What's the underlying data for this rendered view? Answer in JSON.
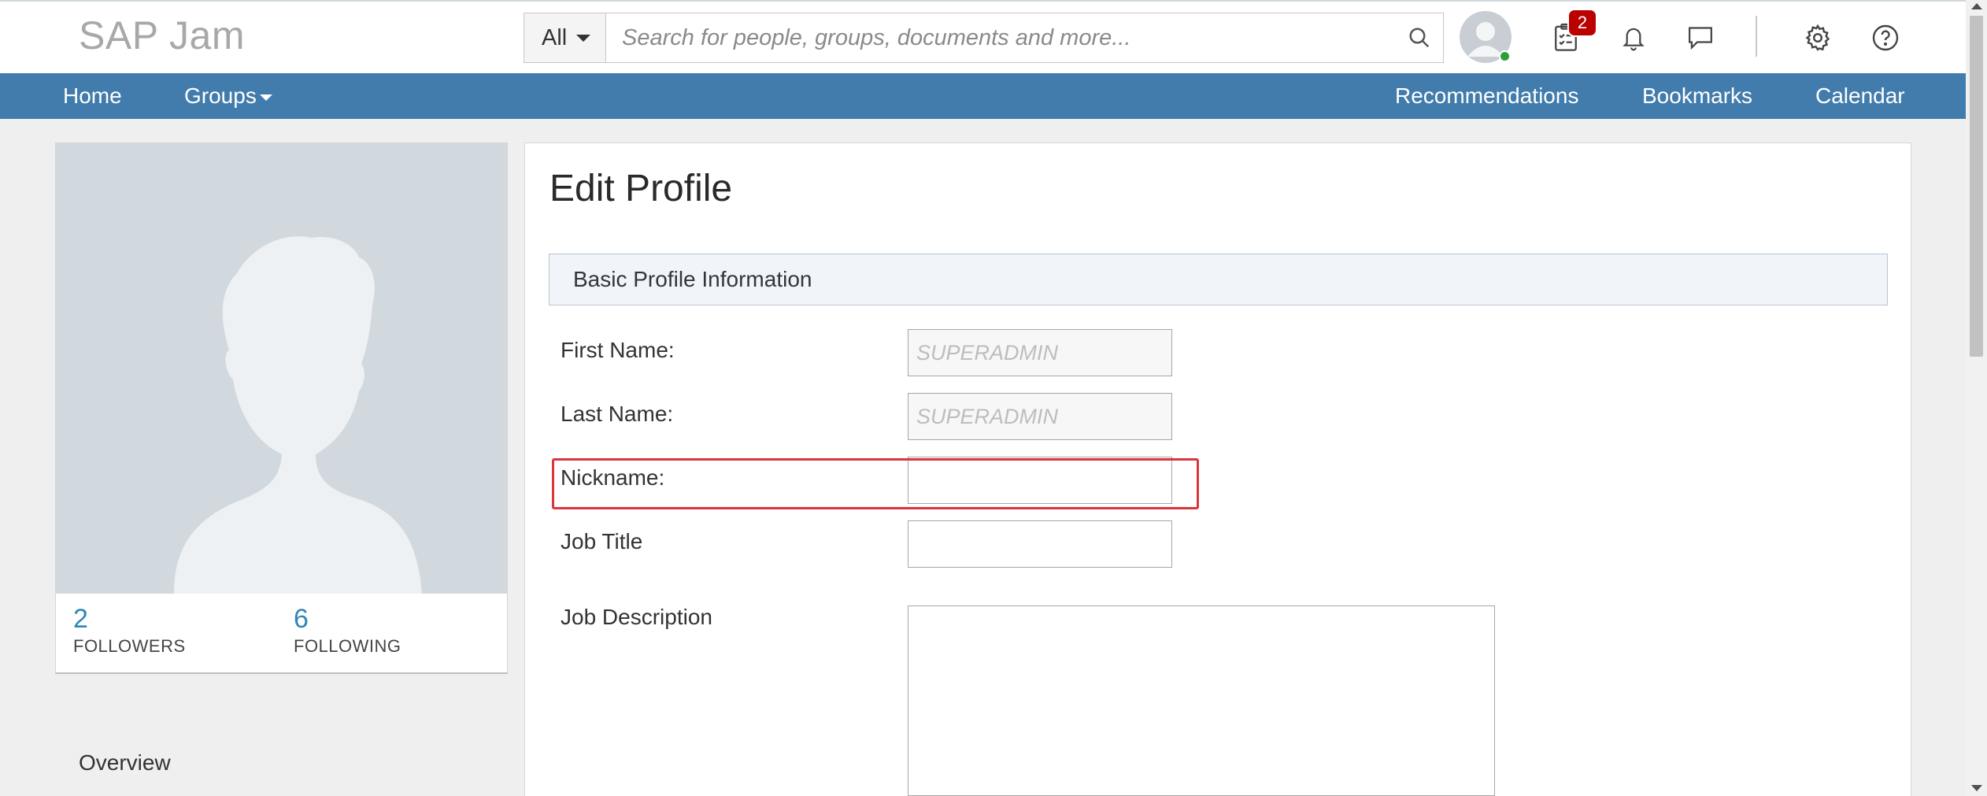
{
  "header": {
    "app_title": "SAP Jam",
    "search": {
      "scope": "All",
      "placeholder": "Search for people, groups, documents and more..."
    },
    "tasks_badge": "2",
    "icons": [
      "avatar",
      "tasks-icon",
      "bell-icon",
      "chat-icon",
      "gear-icon",
      "help-icon",
      "search-icon"
    ]
  },
  "nav": {
    "home": "Home",
    "groups": "Groups",
    "recommendations": "Recommendations",
    "bookmarks": "Bookmarks",
    "calendar": "Calendar"
  },
  "profile_card": {
    "followers_count": "2",
    "followers_label": "FOLLOWERS",
    "following_count": "6",
    "following_label": "FOLLOWING",
    "overview_link": "Overview"
  },
  "edit_profile": {
    "title": "Edit Profile",
    "section": "Basic Profile Information",
    "fields": {
      "first_name": {
        "label": "First Name:",
        "value": "SUPERADMIN"
      },
      "last_name": {
        "label": "Last Name:",
        "value": "SUPERADMIN"
      },
      "nickname": {
        "label": "Nickname:",
        "value": ""
      },
      "job_title": {
        "label": "Job Title",
        "value": ""
      },
      "job_description": {
        "label": "Job Description",
        "value": ""
      }
    }
  },
  "colors": {
    "nav_bar": "#427cac",
    "link_blue": "#2e87b8",
    "badge_red": "#bb0000",
    "highlight_red": "#d9363e",
    "presence_green": "#2e9e3b"
  }
}
